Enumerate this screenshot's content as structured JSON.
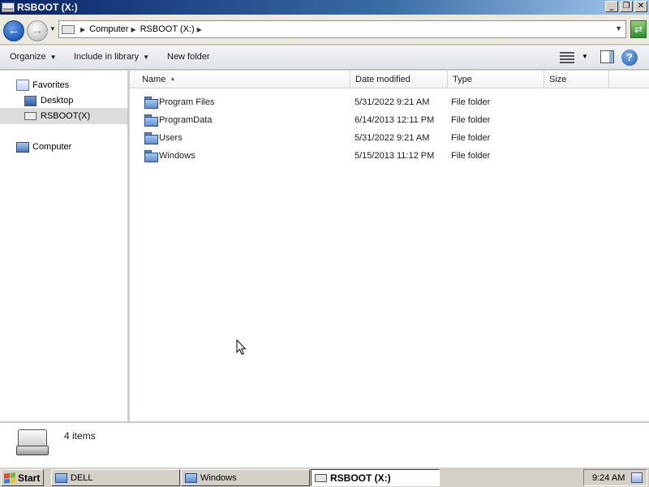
{
  "window": {
    "title": "RSBOOT (X:)",
    "buttons": {
      "minimize": "_",
      "restore": "❐",
      "close": "✕"
    }
  },
  "address": {
    "crumbs": [
      "Computer",
      "RSBOOT (X:)"
    ]
  },
  "toolbar": {
    "organize": "Organize",
    "include_in_library": "Include in library",
    "new_folder": "New folder"
  },
  "nav": {
    "favorites": "Favorites",
    "desktop": "Desktop",
    "rsboot": "RSBOOT(X)",
    "computer": "Computer"
  },
  "columns": {
    "name": "Name",
    "date_modified": "Date modified",
    "type": "Type",
    "size": "Size"
  },
  "files": [
    {
      "name": "Program Files",
      "date": "5/31/2022 9:21 AM",
      "type": "File folder",
      "size": ""
    },
    {
      "name": "ProgramData",
      "date": "6/14/2013 12:11 PM",
      "type": "File folder",
      "size": ""
    },
    {
      "name": "Users",
      "date": "5/31/2022 9:21 AM",
      "type": "File folder",
      "size": ""
    },
    {
      "name": "Windows",
      "date": "5/15/2013 11:12 PM",
      "type": "File folder",
      "size": ""
    }
  ],
  "status": {
    "item_count": "4 items"
  },
  "taskbar": {
    "start": "Start",
    "tasks": [
      "DELL",
      "Windows",
      "RSBOOT (X:)"
    ],
    "clock": "9:24 AM"
  }
}
